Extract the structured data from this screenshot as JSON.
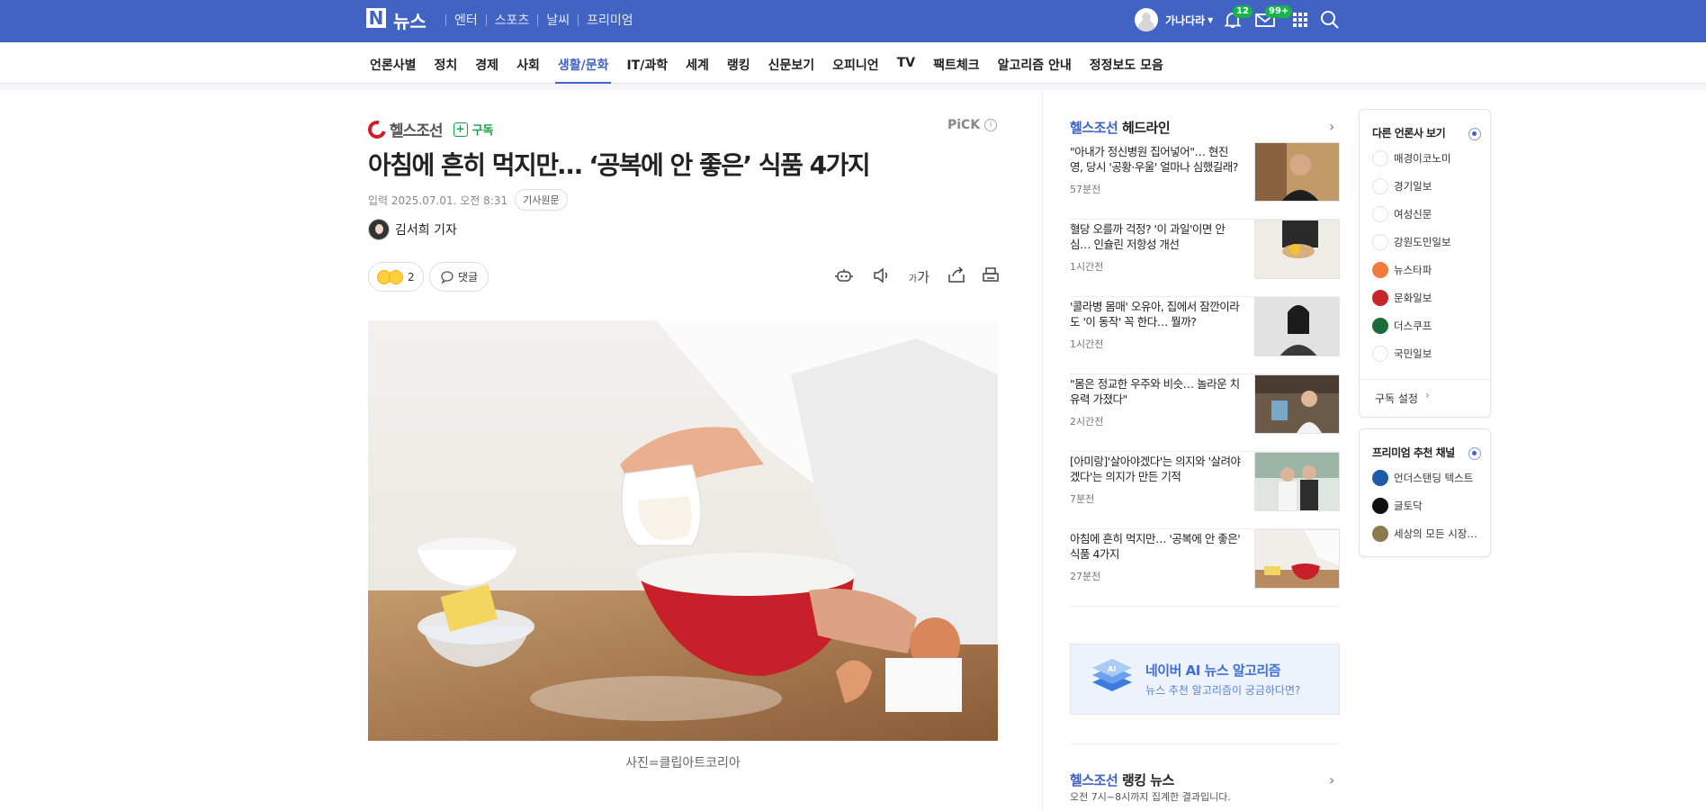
{
  "topbar": {
    "logo": "뉴스",
    "nav": [
      "엔터",
      "스포츠",
      "날씨",
      "프리미엄"
    ],
    "user_name": "가나다라",
    "notification_count": "12",
    "mail_count": "99+"
  },
  "categories": [
    "언론사별",
    "정치",
    "경제",
    "사회",
    "생활/문화",
    "IT/과학",
    "세계",
    "랭킹",
    "신문보기",
    "오피니언",
    "TV",
    "팩트체크",
    "알고리즘 안내",
    "정정보도 모음"
  ],
  "active_category": "생활/문화",
  "article": {
    "press": "헬스조선",
    "subscribe": "구독",
    "pick": "PiCK",
    "title": "아침에 흔히 먹지만… ‘공복에 안 좋은’ 식품 4가지",
    "date": "입력 2025.07.01. 오전 8:31",
    "original_btn": "기사원문",
    "reporter": "김서희 기자",
    "reaction_count": "2",
    "comment_label": "댓글",
    "font_tool": "가",
    "caption": "사진=클립아트코리아"
  },
  "headlines": {
    "press": "헬스조선",
    "label": "헤드라인",
    "items": [
      {
        "title": "\"아내가 정신병원 집어넣어\"… 현진영, 당시 '공황·우울' 얼마나 심했길래?",
        "time": "57분전"
      },
      {
        "title": "혈당 오를까 걱정? '이 과일'이면 안심… 인슐린 저항성 개선",
        "time": "1시간전"
      },
      {
        "title": "'콜라병 몸매' 오유아, 집에서 잠깐이라도 '이 동작' 꼭 한다… 뭘까?",
        "time": "1시간전"
      },
      {
        "title": "\"몸은 정교한 우주와 비슷… 놀라운 치유력 가졌다\"",
        "time": "2시간전"
      },
      {
        "title": "[아미랑]'살아야겠다'는 의지와 '살려야겠다'는 의지가 만든 기적",
        "time": "7분전"
      },
      {
        "title": "아침에 흔히 먹지만… '공복에 안 좋은' 식품 4가지",
        "time": "27분전"
      }
    ]
  },
  "ai_box": {
    "title": "네이버 AI 뉴스 알고리즘",
    "subtitle": "뉴스 추천 알고리즘이 궁금하다면?",
    "icon_text": "AI"
  },
  "ranking": {
    "press": "헬스조선",
    "label": "랭킹 뉴스",
    "subtitle": "오전 7시~8시까지 집계한 결과입니다."
  },
  "other_press": {
    "title": "다른 언론사 보기",
    "items": [
      {
        "name": "매경이코노미",
        "color": "#ffffff"
      },
      {
        "name": "경기일보",
        "color": "#ffffff"
      },
      {
        "name": "여성신문",
        "color": "#ffffff"
      },
      {
        "name": "강원도민일보",
        "color": "#ffffff"
      },
      {
        "name": "뉴스타파",
        "color": "#f07b3f"
      },
      {
        "name": "문화일보",
        "color": "#c8242b"
      },
      {
        "name": "더스쿠프",
        "color": "#1d6b3a"
      },
      {
        "name": "국민일보",
        "color": "#ffffff"
      }
    ],
    "footer": "구독 설정"
  },
  "premium": {
    "title": "프리미엄 추천 채널",
    "items": [
      {
        "name": "언더스탠딩 텍스트",
        "color": "#1f5aa8"
      },
      {
        "name": "글토닥",
        "color": "#111111"
      },
      {
        "name": "세상의 모든 시장…",
        "color": "#8a7a4e"
      }
    ]
  }
}
